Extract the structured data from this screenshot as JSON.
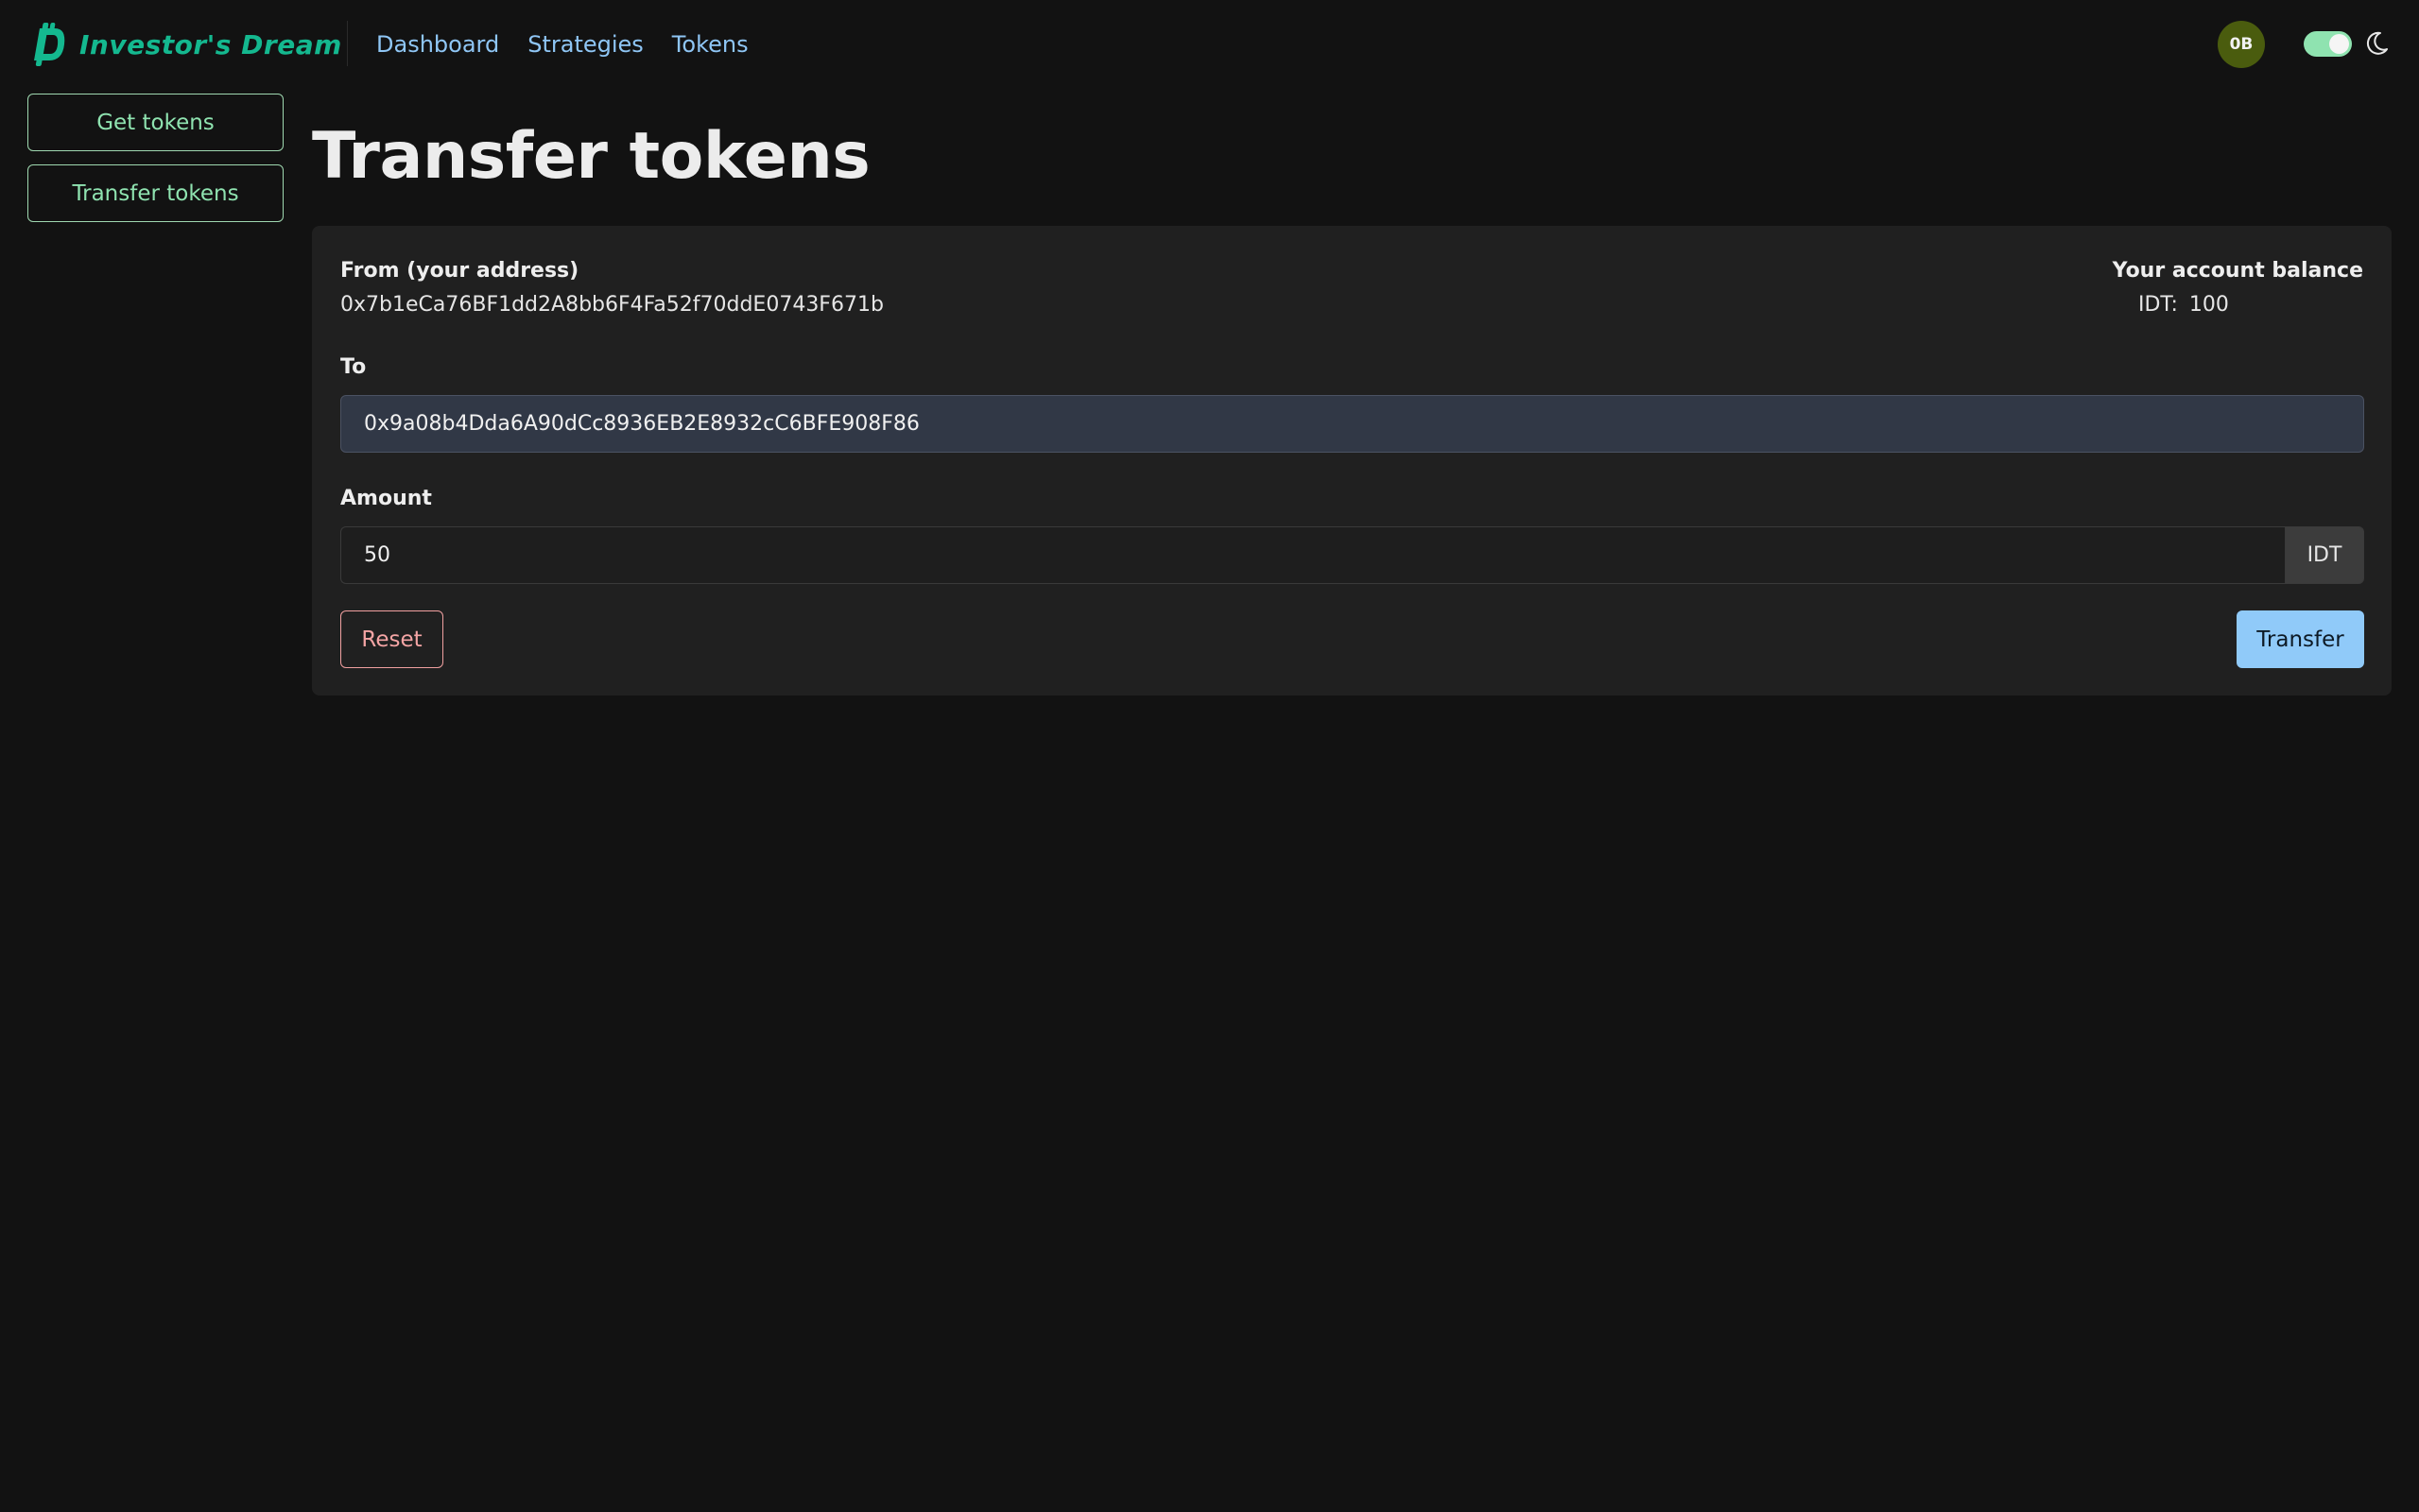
{
  "header": {
    "brand": "Investor's Dream",
    "nav": [
      {
        "label": "Dashboard"
      },
      {
        "label": "Strategies"
      },
      {
        "label": "Tokens"
      }
    ],
    "avatar_initials": "0B",
    "theme_toggle_on": true
  },
  "sidebar": {
    "items": [
      {
        "label": "Get tokens"
      },
      {
        "label": "Transfer tokens"
      }
    ]
  },
  "main": {
    "title": "Transfer tokens",
    "from": {
      "label": "From (your address)",
      "address": "0x7b1eCa76BF1dd2A8bb6F4Fa52f70ddE0743F671b"
    },
    "balance": {
      "label": "Your account balance",
      "currency": "IDT:",
      "amount": "100"
    },
    "to": {
      "label": "To",
      "value": "0x9a08b4Dda6A90dCc8936EB2E8932cC6BFE908F86"
    },
    "amount": {
      "label": "Amount",
      "value": "50",
      "unit": "IDT"
    },
    "reset_label": "Reset",
    "transfer_label": "Transfer"
  },
  "colors": {
    "background": "#121212",
    "card": "#202020",
    "brand": "#14b88f",
    "nav_link": "#8fc6f5",
    "sidebar_accent": "#8fe3b0",
    "reset": "#f5a5a5",
    "transfer_bg": "#90caf9",
    "avatar_bg": "#4a5c0e"
  }
}
